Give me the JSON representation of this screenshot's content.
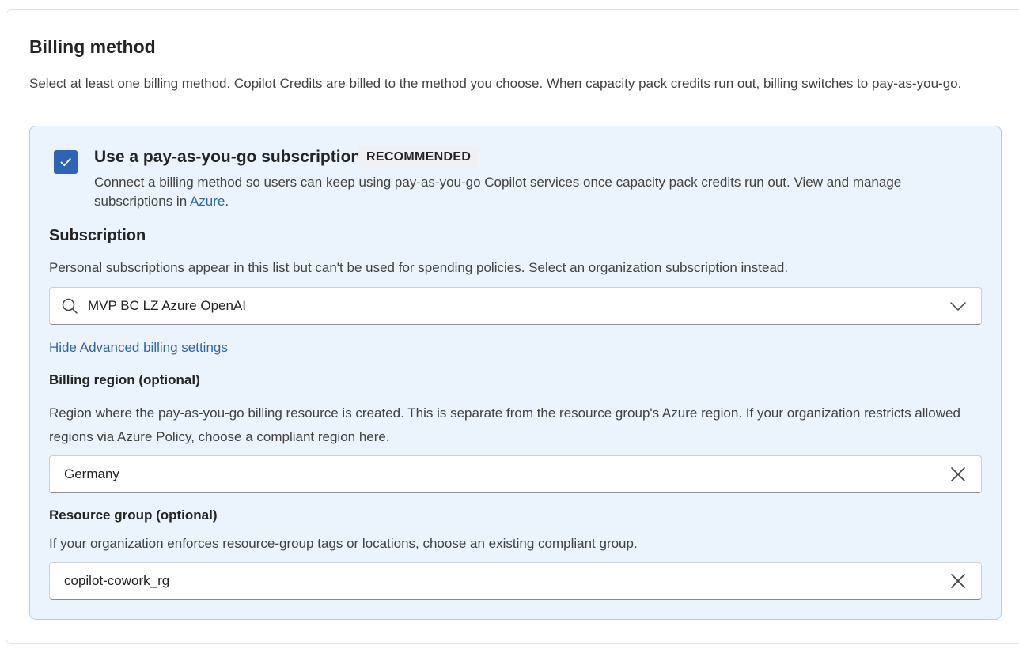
{
  "section": {
    "title": "Billing method",
    "description": "Select at least one billing method. Copilot Credits are billed to the method you choose. When capacity pack credits run out, billing switches to pay-as-you-go."
  },
  "payg": {
    "checked": true,
    "title": "Use a pay-as-you-go subscription",
    "badge": "RECOMMENDED",
    "description_prefix": "Connect a billing method so users can keep using pay-as-you-go Copilot services once capacity pack credits run out. View and manage subscriptions in ",
    "azure_link": "Azure",
    "description_suffix": "."
  },
  "subscription": {
    "title": "Subscription",
    "description": "Personal subscriptions appear in this list but can't be used for spending policies. Select an organization subscription instead.",
    "value": "MVP BC LZ Azure OpenAI"
  },
  "advanced": {
    "toggle_label": "Hide Advanced billing settings"
  },
  "billing_region": {
    "label": "Billing region (optional)",
    "description": "Region where the pay-as-you-go billing resource is created. This is separate from the resource group's Azure region. If your organization restricts allowed regions via Azure Policy, choose a compliant region here.",
    "value": "Germany"
  },
  "resource_group": {
    "label": "Resource group (optional)",
    "description": "If your organization enforces resource-group tags or locations, choose an existing compliant group.",
    "value": "copilot-cowork_rg"
  },
  "colors": {
    "accent": "#2f64b5",
    "link": "#2c68a8",
    "panel_bg": "#ebf3fc",
    "panel_border": "#b4d0ee"
  }
}
